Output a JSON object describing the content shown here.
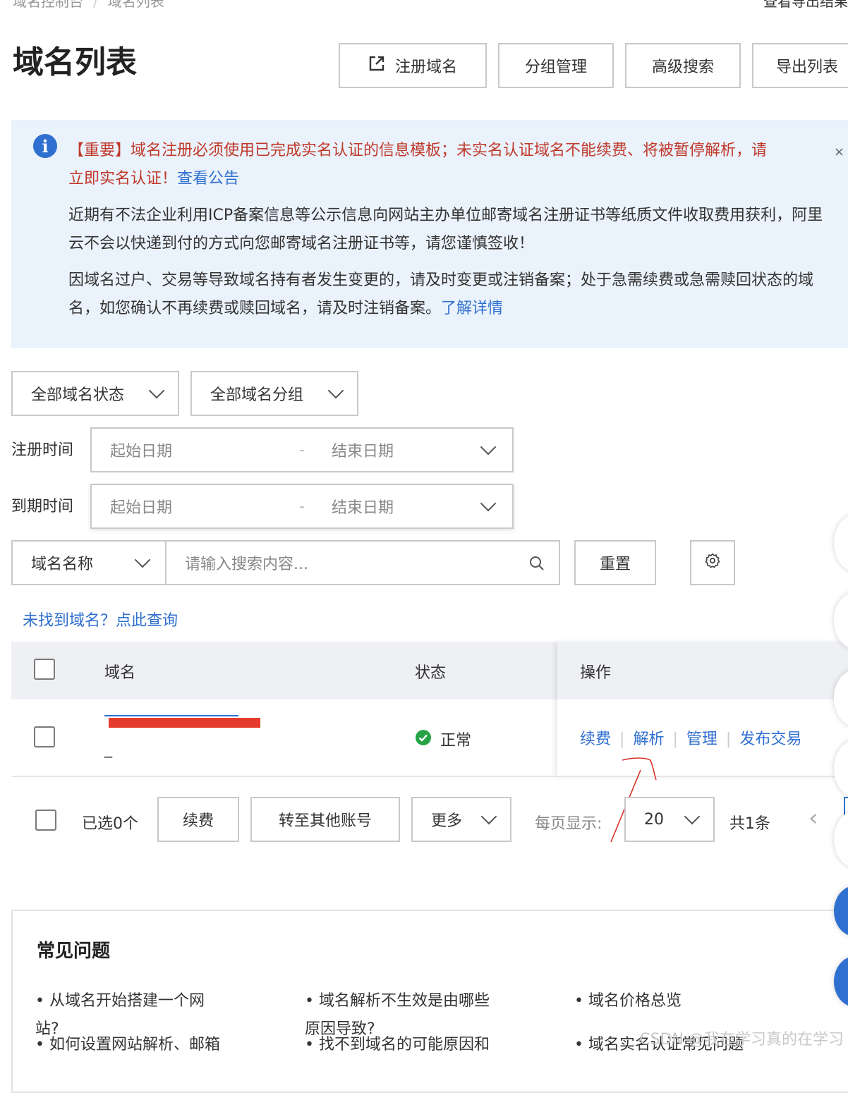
{
  "breadcrumb": {
    "root": "域名控制台",
    "current": "域名列表"
  },
  "header": {
    "title": "域名列表",
    "export_results": "查看导出结果",
    "buttons": {
      "register": "注册域名",
      "group_manage": "分组管理",
      "advanced_search": "高级搜索",
      "export_list": "导出列表"
    }
  },
  "notice": {
    "important_line1": "【重要】域名注册必须使用已完成实名认证的信息模板；未实名认证域名不能续费、将被暂停解析，请",
    "important_line2": "立即实名认证！",
    "view_announcement": "查看公告",
    "para1": "近期有不法企业利用ICP备案信息等公示信息向网站主办单位邮寄域名注册证书等纸质文件收取费用获利，阿里云不会以快递到付的方式向您邮寄域名注册证书等，请您谨慎签收！",
    "para2": "因域名过户、交易等导致域名持有者发生变更的，请及时变更或注销备案；处于急需续费或急需赎回状态的域名，如您确认不再续费或赎回域名，请及时注销备案。",
    "learn_more": "了解详情",
    "close": "×"
  },
  "filters": {
    "status_select": "全部域名状态",
    "group_select": "全部域名分组",
    "reg_time_label": "注册时间",
    "exp_time_label": "到期时间",
    "start_date": "起始日期",
    "end_date": "结束日期",
    "range_sep": "-",
    "search_type": "域名名称",
    "search_placeholder": "请输入搜索内容...",
    "reset": "重置",
    "not_found": "未找到域名？点此查询"
  },
  "table": {
    "headers": {
      "domain": "域名",
      "status": "状态",
      "actions": "操作"
    },
    "rows": [
      {
        "domain_suffix": "_",
        "status": "正常",
        "actions": [
          "续费",
          "解析",
          "管理",
          "发布交易"
        ]
      }
    ]
  },
  "footer": {
    "selected": "已选0个",
    "renew": "续费",
    "transfer": "转至其他账号",
    "more": "更多",
    "per_page_label": "每页显示:",
    "per_page_value": "20",
    "total": "共1条",
    "prev": "‹"
  },
  "faq": {
    "title": "常见问题",
    "items": [
      {
        "line1": "从域名开始搭建一个网",
        "line2": "站?"
      },
      {
        "line1": "域名解析不生效是由哪些",
        "line2": "原因导致?"
      },
      {
        "line1": "域名价格总览",
        "line2": ""
      },
      {
        "line1": "如何设置网站解析、邮箱",
        "line2": ""
      },
      {
        "line1": "找不到域名的可能原因和",
        "line2": ""
      },
      {
        "line1": "域名实名认证常见问题",
        "line2": ""
      }
    ]
  },
  "watermark": "CSDN @我在学习真的在学习",
  "colors": {
    "link": "#2f6fd0",
    "important": "#c0392b",
    "notice_bg": "#eaf2fb",
    "ok": "#25a244",
    "redaction": "#e53b2c",
    "annotation": "#d9322b"
  }
}
